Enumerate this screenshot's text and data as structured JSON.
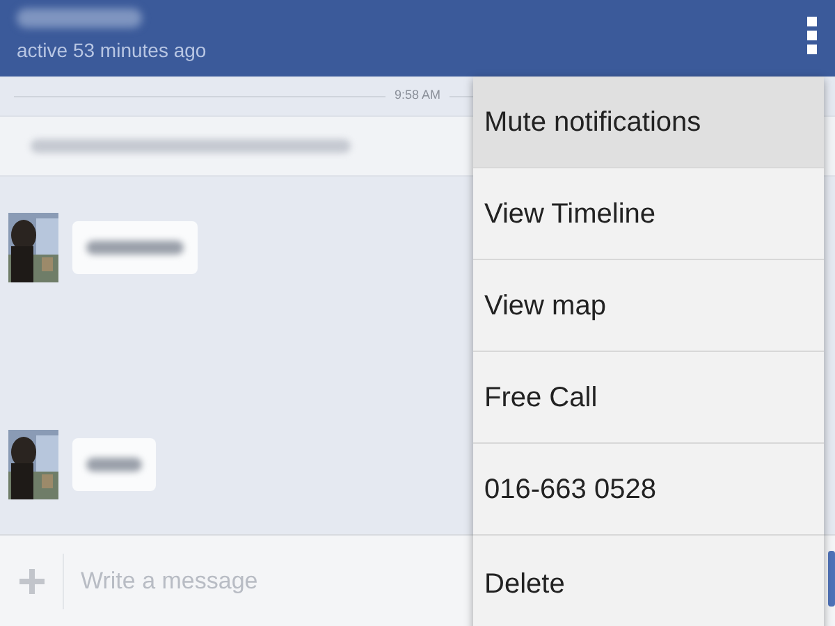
{
  "header": {
    "subtitle": "active 53 minutes ago"
  },
  "timestamp": "9:58 AM",
  "messages": [
    {
      "kind": "incoming"
    },
    {
      "kind": "incoming"
    }
  ],
  "menu": [
    {
      "label": "Mute notifications",
      "selected": true
    },
    {
      "label": "View Timeline",
      "selected": false
    },
    {
      "label": "View map",
      "selected": false
    },
    {
      "label": "Free Call",
      "selected": false
    },
    {
      "label": "016-663 0528",
      "selected": false
    },
    {
      "label": "Delete",
      "selected": false
    }
  ],
  "composer": {
    "placeholder": "Write a message"
  }
}
